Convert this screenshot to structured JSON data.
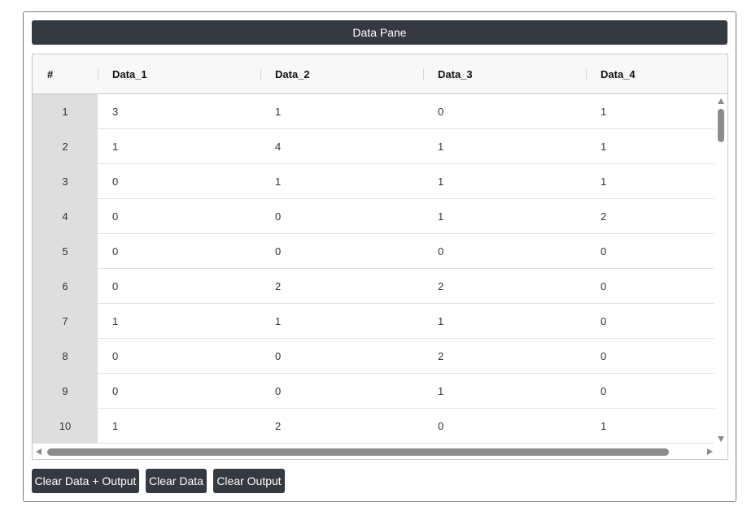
{
  "pane": {
    "title": "Data Pane"
  },
  "table": {
    "columns": [
      "#",
      "Data_1",
      "Data_2",
      "Data_3",
      "Data_4"
    ],
    "rows": [
      [
        "1",
        "3",
        "1",
        "0",
        "1"
      ],
      [
        "2",
        "1",
        "4",
        "1",
        "1"
      ],
      [
        "3",
        "0",
        "1",
        "1",
        "1"
      ],
      [
        "4",
        "0",
        "0",
        "1",
        "2"
      ],
      [
        "5",
        "0",
        "0",
        "0",
        "0"
      ],
      [
        "6",
        "0",
        "2",
        "2",
        "0"
      ],
      [
        "7",
        "1",
        "1",
        "1",
        "0"
      ],
      [
        "8",
        "0",
        "0",
        "2",
        "0"
      ],
      [
        "9",
        "0",
        "0",
        "1",
        "0"
      ],
      [
        "10",
        "1",
        "2",
        "0",
        "1"
      ]
    ]
  },
  "buttons": {
    "clear_all": "Clear Data + Output",
    "clear_data": "Clear Data",
    "clear_output": "Clear Output"
  },
  "colors": {
    "dark": "#343a40",
    "rownum_bg": "#dedede",
    "header_bg": "#f8f8f8"
  }
}
